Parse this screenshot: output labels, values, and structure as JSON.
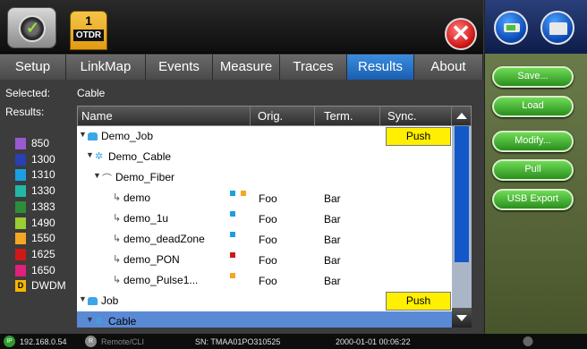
{
  "header": {
    "logo_icon": "viavi-logo-icon",
    "otdr_tab": {
      "number": "1",
      "label": "OTDR"
    },
    "close_icon": "close-icon"
  },
  "tabs": [
    {
      "label": "Setup",
      "active": false
    },
    {
      "label": "LinkMap",
      "active": false
    },
    {
      "label": "Events",
      "active": false
    },
    {
      "label": "Measure",
      "active": false
    },
    {
      "label": "Traces",
      "active": false
    },
    {
      "label": "Results",
      "active": true
    },
    {
      "label": "About",
      "active": false
    }
  ],
  "info": {
    "selected_label": "Selected:",
    "selected_value": "Cable",
    "results_label": "Results:"
  },
  "legend": [
    {
      "label": "850",
      "color": "#9b59d0"
    },
    {
      "label": "1300",
      "color": "#2a3fb0"
    },
    {
      "label": "1310",
      "color": "#1aa0e0"
    },
    {
      "label": "1330",
      "color": "#22b8a8"
    },
    {
      "label": "1383",
      "color": "#2a8e3a"
    },
    {
      "label": "1490",
      "color": "#9acd32"
    },
    {
      "label": "1550",
      "color": "#f5a623"
    },
    {
      "label": "1625",
      "color": "#d01818"
    },
    {
      "label": "1650",
      "color": "#e0207a"
    },
    {
      "label": "DWDM",
      "badge": "D",
      "color": "#f5b800"
    }
  ],
  "table": {
    "columns": [
      "Name",
      "Orig.",
      "Term.",
      "Sync."
    ],
    "rows": [
      {
        "name": "Demo_Job",
        "level": 0,
        "icon": "job-icon",
        "push": "Push"
      },
      {
        "name": "Demo_Cable",
        "level": 1,
        "icon": "cable-icon"
      },
      {
        "name": "Demo_Fiber",
        "level": 2,
        "icon": "fiber-icon"
      },
      {
        "name": "demo",
        "level": 3,
        "icon": "trace-icon",
        "orig": "Foo",
        "term": "Bar",
        "squares": [
          "#1aa0e0",
          "#f5a623"
        ]
      },
      {
        "name": "demo_1u",
        "level": 3,
        "icon": "trace-icon",
        "orig": "Foo",
        "term": "Bar",
        "squares": [
          "#1aa0e0"
        ]
      },
      {
        "name": "demo_deadZone",
        "level": 3,
        "icon": "trace-icon",
        "orig": "Foo",
        "term": "Bar",
        "squares": [
          "#1aa0e0"
        ]
      },
      {
        "name": "demo_PON",
        "level": 3,
        "icon": "trace-icon",
        "orig": "Foo",
        "term": "Bar",
        "squares": [
          "#d01818"
        ]
      },
      {
        "name": "demo_Pulse1...",
        "level": 3,
        "icon": "trace-icon",
        "orig": "Foo",
        "term": "Bar",
        "squares": [
          "#f5a623"
        ]
      },
      {
        "name": "Job",
        "level": 0,
        "icon": "job-icon",
        "push": "Push"
      },
      {
        "name": "Cable",
        "level": 1,
        "icon": "cable-icon"
      }
    ]
  },
  "side_buttons": [
    "Save...",
    "Load",
    "Modify...",
    "Pull",
    "USB Export"
  ],
  "status": {
    "ip_badge": "IP",
    "ip": "192.168.0.54",
    "remote_badge": "R",
    "remote": "Remote/CLI",
    "serial": "SN: TMAA01PO310525",
    "datetime": "2000-01-01 00:06:22"
  }
}
